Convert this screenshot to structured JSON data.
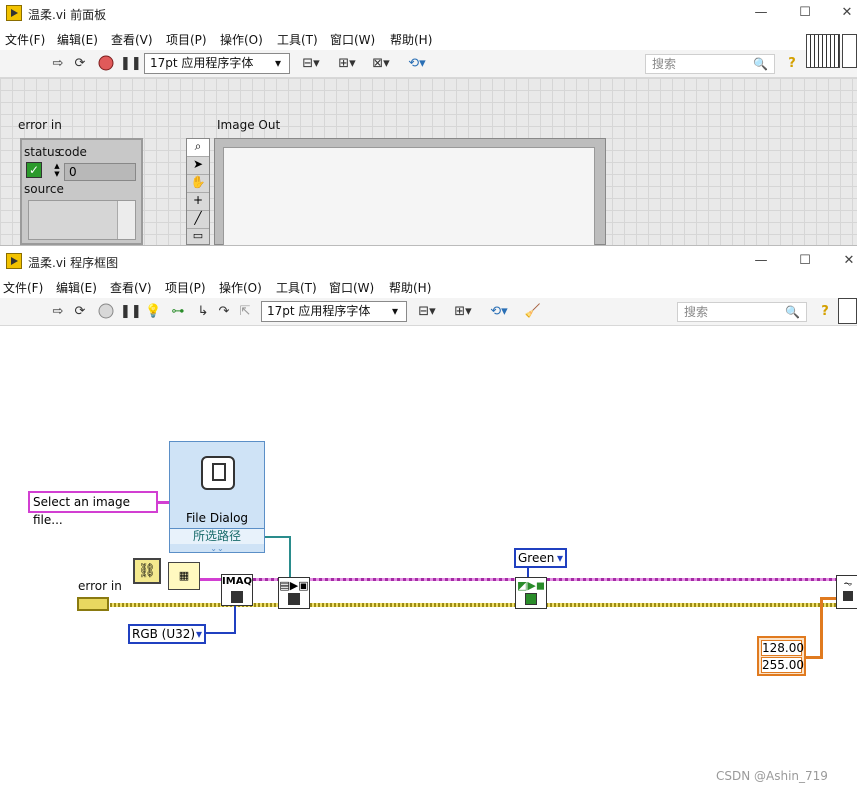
{
  "front_panel": {
    "title": "温柔.vi 前面板",
    "menus": [
      "文件(F)",
      "编辑(E)",
      "查看(V)",
      "项目(P)",
      "操作(O)",
      "工具(T)",
      "窗口(W)",
      "帮助(H)"
    ],
    "font_label": "17pt 应用程序字体",
    "search_placeholder": "搜索",
    "error_in_label": "error in",
    "status_label": "status",
    "code_label": "code",
    "code_value": "0",
    "source_label": "source",
    "image_out_label": "Image Out"
  },
  "block_diagram": {
    "title": "温柔.vi 程序框图",
    "menus": [
      "文件(F)",
      "编辑(E)",
      "查看(V)",
      "项目(P)",
      "操作(O)",
      "工具(T)",
      "窗口(W)",
      "帮助(H)"
    ],
    "font_label": "17pt 应用程序字体",
    "search_placeholder": "搜索",
    "file_dialog_text": "Select an image file...",
    "file_dialog_title": "File Dialog",
    "file_dialog_output": "所选路径",
    "error_in_label": "error in",
    "imaq_label": "IMAQ",
    "image_type": "RGB (U32)",
    "color_plane": "Green",
    "const_value_1": "128.00",
    "const_value_2": "255.00"
  },
  "watermark": "CSDN @Ashin_719",
  "colors": {
    "wire_pink": "#d23fd2",
    "wire_yellow": "#f0e06a",
    "wire_blue": "#2040c0",
    "wire_orange": "#e07a1f",
    "wire_teal": "#2a8c8c"
  }
}
